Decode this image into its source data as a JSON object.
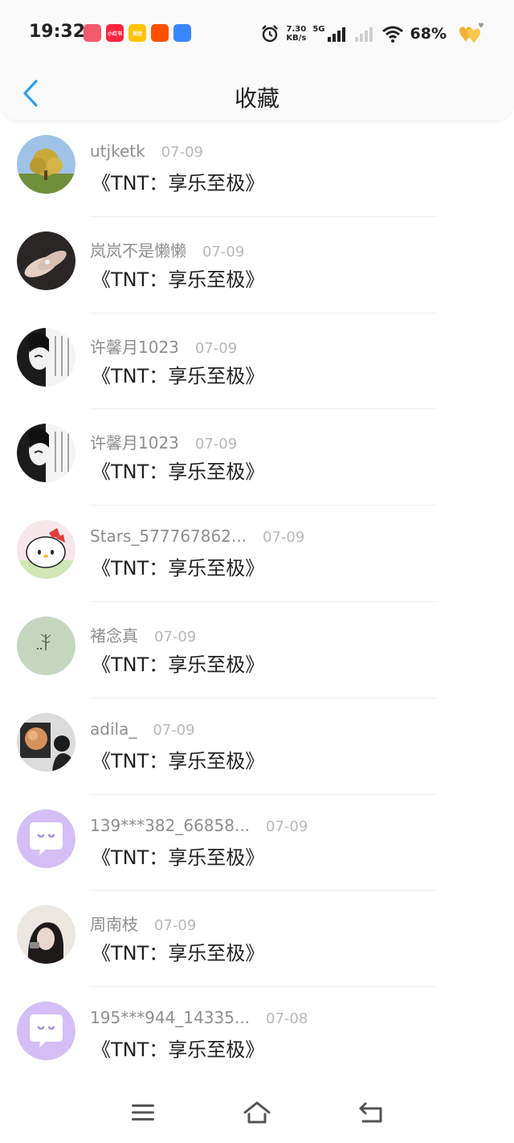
{
  "status_bar": {
    "time": "19:32",
    "app_icons": [
      {
        "name": "douyin-icon",
        "label": "",
        "color": "#f15a6c"
      },
      {
        "name": "xiaohongshu-icon",
        "label": "小红书",
        "color": "#ff2442"
      },
      {
        "name": "meituan-icon",
        "label": "美团",
        "color": "#ffc300"
      },
      {
        "name": "taobao-icon",
        "label": "",
        "color": "#ff5000"
      },
      {
        "name": "browser-icon",
        "label": "",
        "color": "#3a86ff"
      }
    ],
    "net_speed_value": "7.30",
    "net_speed_unit": "KB/s",
    "network": "5G",
    "battery": "68%"
  },
  "nav": {
    "title": "收藏",
    "back_icon": "chevron-left-icon",
    "accent_color": "#2f9fe8"
  },
  "favorites": [
    {
      "username": "utjketk",
      "date": "07-09",
      "content": "《TNT：享乐至极》",
      "avatar": "photo-tree"
    },
    {
      "username": "岚岚不是懒懒",
      "date": "07-09",
      "content": "《TNT：享乐至极》",
      "avatar": "photo-hands"
    },
    {
      "username": "许馨月1023",
      "date": "07-09",
      "content": "《TNT：享乐至极》",
      "avatar": "photo-manga"
    },
    {
      "username": "许馨月1023",
      "date": "07-09",
      "content": "《TNT：享乐至极》",
      "avatar": "photo-manga"
    },
    {
      "username": "Stars_577767862...",
      "date": "07-09",
      "content": "《TNT：享乐至极》",
      "avatar": "photo-kitty"
    },
    {
      "username": "褚念真",
      "date": "07-09",
      "content": "《TNT：享乐至极》",
      "avatar": "photo-green"
    },
    {
      "username": "adila_",
      "date": "07-09",
      "content": "《TNT：享乐至极》",
      "avatar": "photo-moon"
    },
    {
      "username": "139***382_66858...",
      "date": "07-09",
      "content": "《TNT：享乐至极》",
      "avatar": "default-chat"
    },
    {
      "username": "周南枝",
      "date": "07-09",
      "content": "《TNT：享乐至极》",
      "avatar": "photo-girl"
    },
    {
      "username": "195***944_14335...",
      "date": "07-08",
      "content": "《TNT：享乐至极》",
      "avatar": "default-chat"
    }
  ],
  "bottom_nav": {
    "menu_icon": "menu-icon",
    "home_icon": "home-icon",
    "back_icon": "back-arrow-icon"
  }
}
